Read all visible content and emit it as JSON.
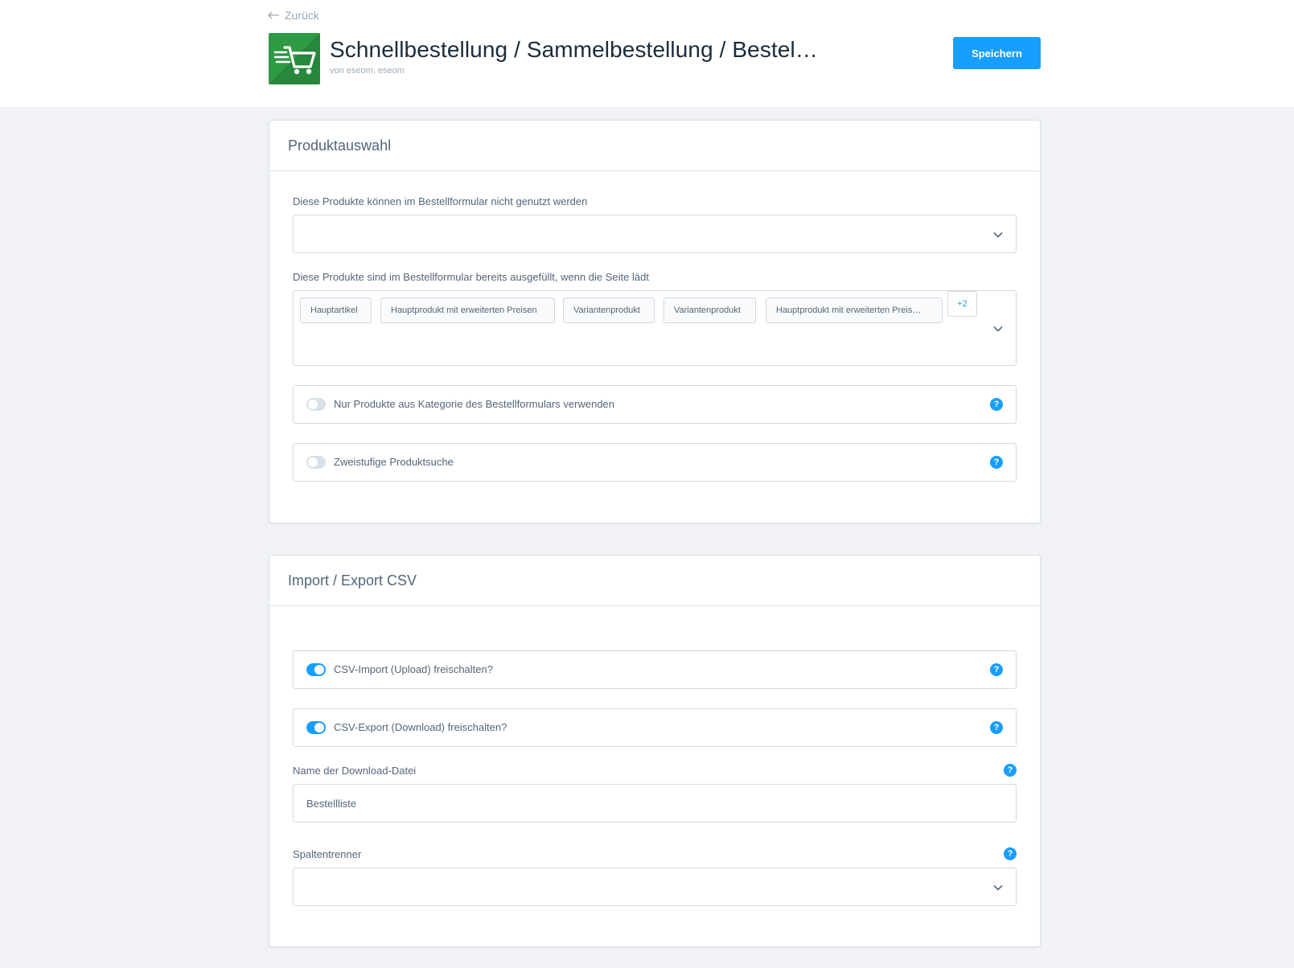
{
  "header": {
    "back_label": "Zurück",
    "app_title": "Schnellbestellung / Sammelbestellung / Bestel…",
    "vendor": "von eseom, eseom",
    "save_label": "Speichern",
    "icon": "cart-icon"
  },
  "colors": {
    "accent": "#189eff",
    "app_icon": "#2e9a44",
    "background": "#f0f2f5"
  },
  "product_selection": {
    "title": "Produktauswahl",
    "excluded_label": "Diese Produkte können im Bestellformular nicht genutzt werden",
    "prefilled_label": "Diese Produkte sind im Bestellformular bereits ausgefüllt, wenn die Seite lädt",
    "prefilled_tags": [
      "Hauptartikel",
      "Hauptprodukt mit erweiterten Preisen",
      "Variantenprodukt",
      "Variantenprodukt",
      "Hauptprodukt mit erweiterten Preis…"
    ],
    "more_count": "+2",
    "toggles": [
      {
        "label": "Nur Produkte aus Kategorie des Bestellformulars verwenden",
        "enabled": false
      },
      {
        "label": "Zweistufige Produktsuche",
        "enabled": false
      }
    ]
  },
  "import_export": {
    "title": "Import / Export CSV",
    "toggles": [
      {
        "label": "CSV-Import (Upload) freischalten?",
        "enabled": true
      },
      {
        "label": "CSV-Export (Download) freischalten?",
        "enabled": true
      }
    ],
    "download_name_label": "Name der Download-Datei",
    "download_name_value": "Bestellliste",
    "separator_label": "Spaltentrenner",
    "separator_value": ""
  },
  "help_symbol": "?"
}
